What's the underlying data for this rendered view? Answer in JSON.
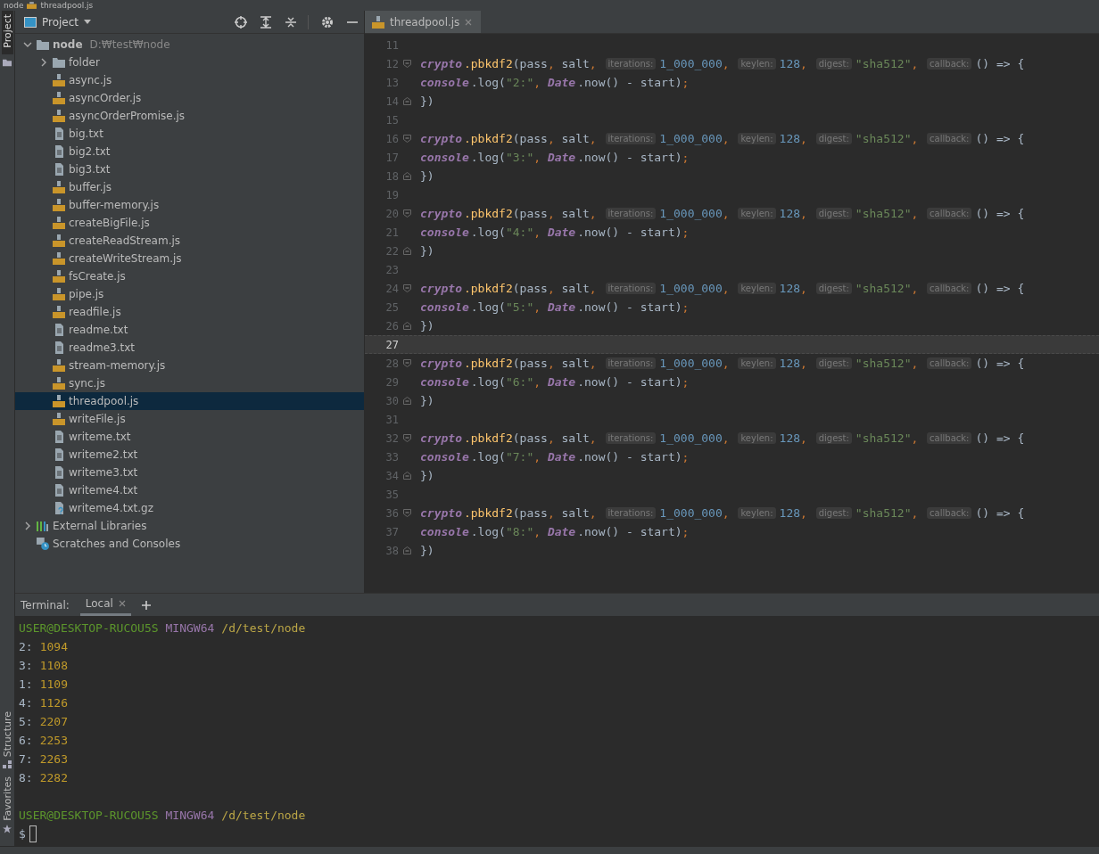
{
  "breadcrumb": [
    {
      "label": "node",
      "kind": "folder"
    },
    {
      "label": "threadpool.js",
      "kind": "js"
    }
  ],
  "side_tabs": {
    "top": [
      {
        "label": "Project",
        "selected": true
      }
    ],
    "bottom": [
      {
        "label": "Structure",
        "kind": "structure"
      },
      {
        "label": "Favorites",
        "kind": "favorites"
      }
    ]
  },
  "project": {
    "title": "Project",
    "tree": [
      {
        "label": "node",
        "path": "D:₩test₩node",
        "kind": "root",
        "expanded": true,
        "selected": false,
        "children": [
          {
            "label": "folder",
            "kind": "folder",
            "expanded": false,
            "selected": false
          },
          {
            "label": "async.js",
            "kind": "js",
            "selected": false
          },
          {
            "label": "asyncOrder.js",
            "kind": "js",
            "selected": false
          },
          {
            "label": "asyncOrderPromise.js",
            "kind": "js",
            "selected": false
          },
          {
            "label": "big.txt",
            "kind": "txt",
            "selected": false
          },
          {
            "label": "big2.txt",
            "kind": "txt",
            "selected": false
          },
          {
            "label": "big3.txt",
            "kind": "txt",
            "selected": false
          },
          {
            "label": "buffer.js",
            "kind": "js",
            "selected": false
          },
          {
            "label": "buffer-memory.js",
            "kind": "js",
            "selected": false
          },
          {
            "label": "createBigFile.js",
            "kind": "js",
            "selected": false
          },
          {
            "label": "createReadStream.js",
            "kind": "js",
            "selected": false
          },
          {
            "label": "createWriteStream.js",
            "kind": "js",
            "selected": false
          },
          {
            "label": "fsCreate.js",
            "kind": "js",
            "selected": false
          },
          {
            "label": "pipe.js",
            "kind": "js",
            "selected": false
          },
          {
            "label": "readfile.js",
            "kind": "js",
            "selected": false
          },
          {
            "label": "readme.txt",
            "kind": "txt",
            "selected": false
          },
          {
            "label": "readme3.txt",
            "kind": "txt",
            "selected": false
          },
          {
            "label": "stream-memory.js",
            "kind": "js",
            "selected": false
          },
          {
            "label": "sync.js",
            "kind": "js",
            "selected": false
          },
          {
            "label": "threadpool.js",
            "kind": "js",
            "selected": true
          },
          {
            "label": "writeFile.js",
            "kind": "js",
            "selected": false
          },
          {
            "label": "writeme.txt",
            "kind": "txt",
            "selected": false
          },
          {
            "label": "writeme2.txt",
            "kind": "txt",
            "selected": false
          },
          {
            "label": "writeme3.txt",
            "kind": "txt",
            "selected": false
          },
          {
            "label": "writeme4.txt",
            "kind": "txt",
            "selected": false
          },
          {
            "label": "writeme4.txt.gz",
            "kind": "unknown",
            "selected": false
          }
        ]
      },
      {
        "label": "External Libraries",
        "kind": "library",
        "expanded": false,
        "selected": false
      },
      {
        "label": "Scratches and Consoles",
        "kind": "scratches",
        "selected": false
      }
    ]
  },
  "editor": {
    "tab": {
      "label": "threadpool.js",
      "selected": true
    },
    "lines": [
      {
        "number": "11",
        "kind": "blank",
        "current": false
      },
      {
        "number": "12",
        "kind": "top",
        "current": false,
        "fold_start": true,
        "tokens": [
          {
            "text": "crypto",
            "kind": "global"
          },
          {
            "text": ".pbkdf2",
            "kind": "method"
          },
          {
            "text": "(pass",
            "kind": "plain"
          },
          {
            "text": ",",
            "kind": "punct"
          },
          {
            "text": "salt",
            "kind": "plain"
          },
          {
            "text": ",",
            "kind": "punct"
          },
          {
            "text": "iterations:",
            "kind": "hint"
          },
          {
            "text": "1_000_000",
            "kind": "number"
          },
          {
            "text": ",",
            "kind": "punct"
          },
          {
            "text": "keylen:",
            "kind": "hint"
          },
          {
            "text": "128",
            "kind": "number"
          },
          {
            "text": ",",
            "kind": "punct"
          },
          {
            "text": "digest:",
            "kind": "hint"
          },
          {
            "text": "\"sha512\"",
            "kind": "string"
          },
          {
            "text": ",",
            "kind": "punct"
          },
          {
            "text": "callback:",
            "kind": "hint"
          },
          {
            "text": "() => {",
            "kind": "plain"
          }
        ]
      },
      {
        "number": "13",
        "kind": "nested",
        "current": false,
        "tokens": [
          {
            "text": "console",
            "kind": "global"
          },
          {
            "text": ".log(",
            "kind": "plain"
          },
          {
            "text": "\"2:\"",
            "kind": "string"
          },
          {
            "text": ",",
            "kind": "punct"
          },
          {
            "text": "Date",
            "kind": "global"
          },
          {
            "text": ".now() - start)",
            "kind": "plain"
          },
          {
            "text": ";",
            "kind": "punct"
          }
        ]
      },
      {
        "number": "14",
        "kind": "top",
        "current": false,
        "fold_end": true,
        "tokens": [
          {
            "text": "})",
            "kind": "plain"
          }
        ]
      },
      {
        "number": "15",
        "kind": "blank",
        "current": false
      },
      {
        "number": "16",
        "kind": "top",
        "current": false,
        "fold_start": true,
        "tokens": [
          {
            "text": "crypto",
            "kind": "global"
          },
          {
            "text": ".pbkdf2",
            "kind": "method"
          },
          {
            "text": "(pass",
            "kind": "plain"
          },
          {
            "text": ",",
            "kind": "punct"
          },
          {
            "text": "salt",
            "kind": "plain"
          },
          {
            "text": ",",
            "kind": "punct"
          },
          {
            "text": "iterations:",
            "kind": "hint"
          },
          {
            "text": "1_000_000",
            "kind": "number"
          },
          {
            "text": ",",
            "kind": "punct"
          },
          {
            "text": "keylen:",
            "kind": "hint"
          },
          {
            "text": "128",
            "kind": "number"
          },
          {
            "text": ",",
            "kind": "punct"
          },
          {
            "text": "digest:",
            "kind": "hint"
          },
          {
            "text": "\"sha512\"",
            "kind": "string"
          },
          {
            "text": ",",
            "kind": "punct"
          },
          {
            "text": "callback:",
            "kind": "hint"
          },
          {
            "text": "() => {",
            "kind": "plain"
          }
        ]
      },
      {
        "number": "17",
        "kind": "nested",
        "current": false,
        "tokens": [
          {
            "text": "console",
            "kind": "global"
          },
          {
            "text": ".log(",
            "kind": "plain"
          },
          {
            "text": "\"3:\"",
            "kind": "string"
          },
          {
            "text": ",",
            "kind": "punct"
          },
          {
            "text": "Date",
            "kind": "global"
          },
          {
            "text": ".now() - start)",
            "kind": "plain"
          },
          {
            "text": ";",
            "kind": "punct"
          }
        ]
      },
      {
        "number": "18",
        "kind": "top",
        "current": false,
        "fold_end": true,
        "tokens": [
          {
            "text": "})",
            "kind": "plain"
          }
        ]
      },
      {
        "number": "19",
        "kind": "blank",
        "current": false
      },
      {
        "number": "20",
        "kind": "top",
        "current": false,
        "fold_start": true,
        "tokens": [
          {
            "text": "crypto",
            "kind": "global"
          },
          {
            "text": ".pbkdf2",
            "kind": "method"
          },
          {
            "text": "(pass",
            "kind": "plain"
          },
          {
            "text": ",",
            "kind": "punct"
          },
          {
            "text": "salt",
            "kind": "plain"
          },
          {
            "text": ",",
            "kind": "punct"
          },
          {
            "text": "iterations:",
            "kind": "hint"
          },
          {
            "text": "1_000_000",
            "kind": "number"
          },
          {
            "text": ",",
            "kind": "punct"
          },
          {
            "text": "keylen:",
            "kind": "hint"
          },
          {
            "text": "128",
            "kind": "number"
          },
          {
            "text": ",",
            "kind": "punct"
          },
          {
            "text": "digest:",
            "kind": "hint"
          },
          {
            "text": "\"sha512\"",
            "kind": "string"
          },
          {
            "text": ",",
            "kind": "punct"
          },
          {
            "text": "callback:",
            "kind": "hint"
          },
          {
            "text": "() => {",
            "kind": "plain"
          }
        ]
      },
      {
        "number": "21",
        "kind": "nested",
        "current": false,
        "tokens": [
          {
            "text": "console",
            "kind": "global"
          },
          {
            "text": ".log(",
            "kind": "plain"
          },
          {
            "text": "\"4:\"",
            "kind": "string"
          },
          {
            "text": ",",
            "kind": "punct"
          },
          {
            "text": "Date",
            "kind": "global"
          },
          {
            "text": ".now() - start)",
            "kind": "plain"
          },
          {
            "text": ";",
            "kind": "punct"
          }
        ]
      },
      {
        "number": "22",
        "kind": "top",
        "current": false,
        "fold_end": true,
        "tokens": [
          {
            "text": "})",
            "kind": "plain"
          }
        ]
      },
      {
        "number": "23",
        "kind": "blank",
        "current": false
      },
      {
        "number": "24",
        "kind": "top",
        "current": false,
        "fold_start": true,
        "tokens": [
          {
            "text": "crypto",
            "kind": "global"
          },
          {
            "text": ".pbkdf2",
            "kind": "method"
          },
          {
            "text": "(pass",
            "kind": "plain"
          },
          {
            "text": ",",
            "kind": "punct"
          },
          {
            "text": "salt",
            "kind": "plain"
          },
          {
            "text": ",",
            "kind": "punct"
          },
          {
            "text": "iterations:",
            "kind": "hint"
          },
          {
            "text": "1_000_000",
            "kind": "number"
          },
          {
            "text": ",",
            "kind": "punct"
          },
          {
            "text": "keylen:",
            "kind": "hint"
          },
          {
            "text": "128",
            "kind": "number"
          },
          {
            "text": ",",
            "kind": "punct"
          },
          {
            "text": "digest:",
            "kind": "hint"
          },
          {
            "text": "\"sha512\"",
            "kind": "string"
          },
          {
            "text": ",",
            "kind": "punct"
          },
          {
            "text": "callback:",
            "kind": "hint"
          },
          {
            "text": "() => {",
            "kind": "plain"
          }
        ]
      },
      {
        "number": "25",
        "kind": "nested",
        "current": false,
        "tokens": [
          {
            "text": "console",
            "kind": "global"
          },
          {
            "text": ".log(",
            "kind": "plain"
          },
          {
            "text": "\"5:\"",
            "kind": "string"
          },
          {
            "text": ",",
            "kind": "punct"
          },
          {
            "text": "Date",
            "kind": "global"
          },
          {
            "text": ".now() - start)",
            "kind": "plain"
          },
          {
            "text": ";",
            "kind": "punct"
          }
        ]
      },
      {
        "number": "26",
        "kind": "top",
        "current": false,
        "fold_end": true,
        "tokens": [
          {
            "text": "})",
            "kind": "plain"
          }
        ]
      },
      {
        "number": "27",
        "kind": "blank",
        "current": true
      },
      {
        "number": "28",
        "kind": "top",
        "current": false,
        "fold_start": true,
        "tokens": [
          {
            "text": "crypto",
            "kind": "global"
          },
          {
            "text": ".pbkdf2",
            "kind": "method"
          },
          {
            "text": "(pass",
            "kind": "plain"
          },
          {
            "text": ",",
            "kind": "punct"
          },
          {
            "text": "salt",
            "kind": "plain"
          },
          {
            "text": ",",
            "kind": "punct"
          },
          {
            "text": "iterations:",
            "kind": "hint"
          },
          {
            "text": "1_000_000",
            "kind": "number"
          },
          {
            "text": ",",
            "kind": "punct"
          },
          {
            "text": "keylen:",
            "kind": "hint"
          },
          {
            "text": "128",
            "kind": "number"
          },
          {
            "text": ",",
            "kind": "punct"
          },
          {
            "text": "digest:",
            "kind": "hint"
          },
          {
            "text": "\"sha512\"",
            "kind": "string"
          },
          {
            "text": ",",
            "kind": "punct"
          },
          {
            "text": "callback:",
            "kind": "hint"
          },
          {
            "text": "() => {",
            "kind": "plain"
          }
        ]
      },
      {
        "number": "29",
        "kind": "nested",
        "current": false,
        "tokens": [
          {
            "text": "console",
            "kind": "global"
          },
          {
            "text": ".log(",
            "kind": "plain"
          },
          {
            "text": "\"6:\"",
            "kind": "string"
          },
          {
            "text": ",",
            "kind": "punct"
          },
          {
            "text": "Date",
            "kind": "global"
          },
          {
            "text": ".now() - start)",
            "kind": "plain"
          },
          {
            "text": ";",
            "kind": "punct"
          }
        ]
      },
      {
        "number": "30",
        "kind": "top",
        "current": false,
        "fold_end": true,
        "tokens": [
          {
            "text": "})",
            "kind": "plain"
          }
        ]
      },
      {
        "number": "31",
        "kind": "blank",
        "current": false
      },
      {
        "number": "32",
        "kind": "top",
        "current": false,
        "fold_start": true,
        "tokens": [
          {
            "text": "crypto",
            "kind": "global"
          },
          {
            "text": ".pbkdf2",
            "kind": "method"
          },
          {
            "text": "(pass",
            "kind": "plain"
          },
          {
            "text": ",",
            "kind": "punct"
          },
          {
            "text": "salt",
            "kind": "plain"
          },
          {
            "text": ",",
            "kind": "punct"
          },
          {
            "text": "iterations:",
            "kind": "hint"
          },
          {
            "text": "1_000_000",
            "kind": "number"
          },
          {
            "text": ",",
            "kind": "punct"
          },
          {
            "text": "keylen:",
            "kind": "hint"
          },
          {
            "text": "128",
            "kind": "number"
          },
          {
            "text": ",",
            "kind": "punct"
          },
          {
            "text": "digest:",
            "kind": "hint"
          },
          {
            "text": "\"sha512\"",
            "kind": "string"
          },
          {
            "text": ",",
            "kind": "punct"
          },
          {
            "text": "callback:",
            "kind": "hint"
          },
          {
            "text": "() => {",
            "kind": "plain"
          }
        ]
      },
      {
        "number": "33",
        "kind": "nested",
        "current": false,
        "tokens": [
          {
            "text": "console",
            "kind": "global"
          },
          {
            "text": ".log(",
            "kind": "plain"
          },
          {
            "text": "\"7:\"",
            "kind": "string"
          },
          {
            "text": ",",
            "kind": "punct"
          },
          {
            "text": "Date",
            "kind": "global"
          },
          {
            "text": ".now() - start)",
            "kind": "plain"
          },
          {
            "text": ";",
            "kind": "punct"
          }
        ]
      },
      {
        "number": "34",
        "kind": "top",
        "current": false,
        "fold_end": true,
        "tokens": [
          {
            "text": "})",
            "kind": "plain"
          }
        ]
      },
      {
        "number": "35",
        "kind": "blank",
        "current": false
      },
      {
        "number": "36",
        "kind": "top",
        "current": false,
        "fold_start": true,
        "tokens": [
          {
            "text": "crypto",
            "kind": "global"
          },
          {
            "text": ".pbkdf2",
            "kind": "method"
          },
          {
            "text": "(pass",
            "kind": "plain"
          },
          {
            "text": ",",
            "kind": "punct"
          },
          {
            "text": "salt",
            "kind": "plain"
          },
          {
            "text": ",",
            "kind": "punct"
          },
          {
            "text": "iterations:",
            "kind": "hint"
          },
          {
            "text": "1_000_000",
            "kind": "number"
          },
          {
            "text": ",",
            "kind": "punct"
          },
          {
            "text": "keylen:",
            "kind": "hint"
          },
          {
            "text": "128",
            "kind": "number"
          },
          {
            "text": ",",
            "kind": "punct"
          },
          {
            "text": "digest:",
            "kind": "hint"
          },
          {
            "text": "\"sha512\"",
            "kind": "string"
          },
          {
            "text": ",",
            "kind": "punct"
          },
          {
            "text": "callback:",
            "kind": "hint"
          },
          {
            "text": "() => {",
            "kind": "plain"
          }
        ]
      },
      {
        "number": "37",
        "kind": "nested",
        "current": false,
        "tokens": [
          {
            "text": "console",
            "kind": "global"
          },
          {
            "text": ".log(",
            "kind": "plain"
          },
          {
            "text": "\"8:\"",
            "kind": "string"
          },
          {
            "text": ",",
            "kind": "punct"
          },
          {
            "text": "Date",
            "kind": "global"
          },
          {
            "text": ".now() - start)",
            "kind": "plain"
          },
          {
            "text": ";",
            "kind": "punct"
          }
        ]
      },
      {
        "number": "38",
        "kind": "top",
        "current": false,
        "fold_end": true,
        "tokens": [
          {
            "text": "})",
            "kind": "plain"
          }
        ]
      }
    ]
  },
  "terminal": {
    "title": "Terminal:",
    "tabs": [
      {
        "label": "Local",
        "selected": true
      }
    ],
    "lines": [
      {
        "kind": "prompt",
        "user": "USER@DESKTOP-RUCOU5S",
        "shell": "MINGW64",
        "path": "/d/test/node"
      },
      {
        "kind": "output",
        "label": "2:",
        "value": "1094"
      },
      {
        "kind": "output",
        "label": "3:",
        "value": "1108"
      },
      {
        "kind": "output",
        "label": "1:",
        "value": "1109"
      },
      {
        "kind": "output",
        "label": "4:",
        "value": "1126"
      },
      {
        "kind": "output",
        "label": "5:",
        "value": "2207"
      },
      {
        "kind": "output",
        "label": "6:",
        "value": "2253"
      },
      {
        "kind": "output",
        "label": "7:",
        "value": "2263"
      },
      {
        "kind": "output",
        "label": "8:",
        "value": "2282"
      },
      {
        "kind": "blank"
      },
      {
        "kind": "prompt",
        "user": "USER@DESKTOP-RUCOU5S",
        "shell": "MINGW64",
        "path": "/d/test/node"
      },
      {
        "kind": "input",
        "symbol": "$"
      }
    ]
  }
}
